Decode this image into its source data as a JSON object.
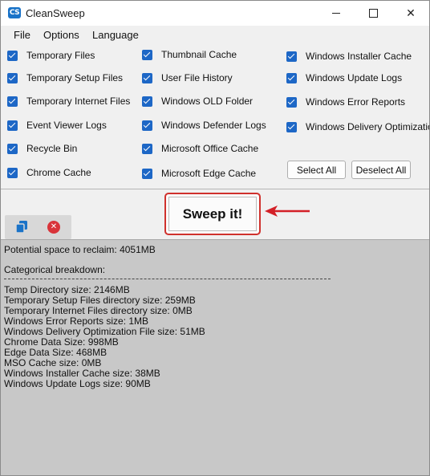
{
  "window": {
    "icon_text": "CS",
    "title": "CleanSweep",
    "close_glyph": "✕"
  },
  "menu": {
    "file": "File",
    "options": "Options",
    "language": "Language"
  },
  "checkboxes": {
    "col1": [
      "Temporary Files",
      "Temporary Setup Files",
      "Temporary Internet Files",
      "Event Viewer Logs",
      "Recycle Bin",
      "Chrome Cache"
    ],
    "col2": [
      "Thumbnail Cache",
      "User File History",
      "Windows OLD Folder",
      "Windows Defender Logs",
      "Microsoft Office Cache",
      "Microsoft Edge Cache"
    ],
    "col3": [
      "Windows Installer Cache",
      "Windows Update Logs",
      "Windows Error Reports",
      "Windows Delivery Optimization"
    ]
  },
  "buttons": {
    "select_all": "Select All",
    "deselect_all": "Deselect All",
    "sweep": "Sweep it!"
  },
  "accent_colors": {
    "checkbox": "#1d67c6",
    "sweep_border": "#d0312d",
    "arrow": "#d32027"
  },
  "icons": {
    "copy": "copy-icon",
    "clear": "clear-icon",
    "clear_glyph": "✕"
  },
  "output": {
    "potential": "Potential space to reclaim: 4051MB",
    "breakdown_header": "Categorical breakdown:",
    "lines": [
      "Temp Directory size: 2146MB",
      "Temporary Setup Files directory size: 259MB",
      "Temporary Internet Files directory size: 0MB",
      "Windows Error Reports size: 1MB",
      "Windows Delivery Optimization File size: 51MB",
      "Chrome Data Size: 998MB",
      "Edge Data Size: 468MB",
      "MSO Cache size: 0MB",
      "Windows Installer Cache size: 38MB",
      "Windows Update Logs size: 90MB"
    ]
  }
}
